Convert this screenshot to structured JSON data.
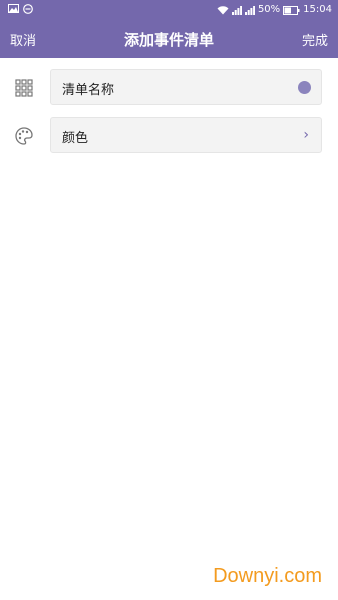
{
  "status_bar": {
    "battery": "50%",
    "time": "15:04",
    "icons": [
      "image-icon",
      "minus-circle-icon",
      "wifi-icon",
      "signal-icon",
      "signal-icon",
      "battery-icon"
    ]
  },
  "toolbar": {
    "cancel_label": "取消",
    "title": "添加事件清单",
    "done_label": "完成"
  },
  "form": {
    "name_field": {
      "label": "清单名称",
      "icon": "grid-icon",
      "dot_color": "#8b84bd"
    },
    "color_field": {
      "label": "颜色",
      "icon": "palette-icon",
      "chevron": "›"
    }
  },
  "watermark": "Downyi.com",
  "colors": {
    "accent": "#7468ac",
    "field_bg": "#f3f3f3",
    "watermark": "#f39b1f"
  }
}
